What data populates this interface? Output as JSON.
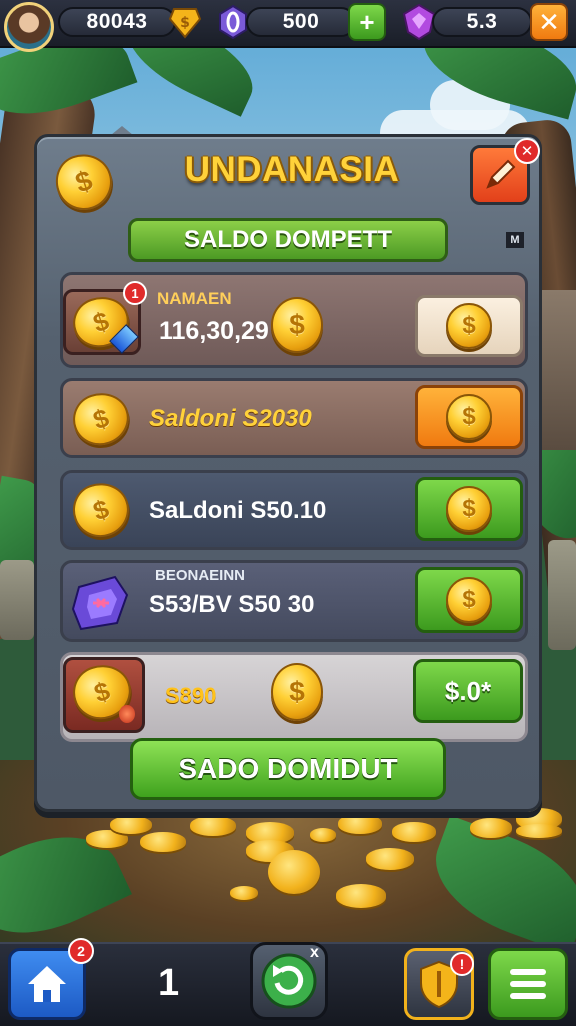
{
  "top_bar": {
    "coins_value": "80043",
    "gems_value": "500",
    "crystals_value": "5.3",
    "add_label": "+",
    "close_label": "✕"
  },
  "panel": {
    "title": "UNDANASIA",
    "header_button": "SALDO DOMPETT",
    "mini_icon": "M",
    "rows": [
      {
        "tag": "NAMAEN",
        "value": "116,30,29",
        "badge": "1"
      },
      {
        "value": "Saldoni  S2030"
      },
      {
        "value": "SaLdoni  S50.10"
      },
      {
        "tag": "BEONAEINN",
        "value": "S53/BV  S50 30"
      },
      {
        "value": "S890",
        "button_label": "$.0*"
      }
    ],
    "bottom_button": "SADO DOMIDUT"
  },
  "bottom_nav": {
    "home_badge": "2",
    "counter": "1",
    "refresh_badge": "x",
    "shield_badge": "!"
  },
  "colors": {
    "title_gold": "#ffd23a",
    "green_button": "#4c9a24",
    "orange_button": "#f07a10",
    "badge_red": "#e02a2a"
  },
  "icons": [
    "avatar",
    "coin-icon",
    "gem-icon",
    "plus-icon",
    "crystal-icon",
    "close-icon",
    "edit-icon",
    "shield-gem-icon",
    "home-icon",
    "refresh-icon",
    "shield-icon",
    "menu-icon"
  ]
}
